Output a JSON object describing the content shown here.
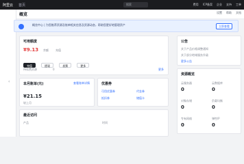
{
  "topbar": {
    "logo": "阿里云",
    "tag": "首页",
    "search_placeholder": "搜索",
    "links": [
      "费用",
      "ICP备案",
      "企业",
      "支持",
      "工单"
    ]
  },
  "page": {
    "title": "概览",
    "tools": [
      "设置",
      "帮助",
      "文档"
    ]
  },
  "banner": {
    "text": "概览中心 | 为您推荐资源及账单相关信息及资源动态，帮助您更好地管理资产",
    "button": "立即查看"
  },
  "account": {
    "title": "可用额度",
    "value": "¥9.13",
    "sub": "余额",
    "sub2": "充值",
    "pills": [
      "充值",
      "提现",
      "发票",
      "更多"
    ],
    "footer1": "待续费资源",
    "footer2": "0",
    "more": "更多"
  },
  "bill": {
    "title": "本月账单(元)",
    "value": "¥21.15",
    "note": "较上月",
    "link": "查看账单详情"
  },
  "coupon": {
    "title": "优惠券",
    "items": [
      "可用优惠券",
      "代金券",
      "抵扣券",
      "储值卡"
    ]
  },
  "recent": {
    "title": "最近访问",
    "cols": [
      "产品",
      "时间"
    ]
  },
  "right_notice": {
    "title": "公告",
    "items": [
      "关于产品价格调整通知",
      "关于部分地域服务升级",
      "更多公告"
    ]
  },
  "resources": {
    "title": "资源概览",
    "label1": "云服务器",
    "val1": "0",
    "label2": "云数据库",
    "val2": "0",
    "label3": "对象存储",
    "val3": "0",
    "label4": "负载均衡",
    "val4": "0",
    "label5": "专有网络",
    "val5": "0",
    "label6": "弹性IP",
    "val6": "0"
  }
}
